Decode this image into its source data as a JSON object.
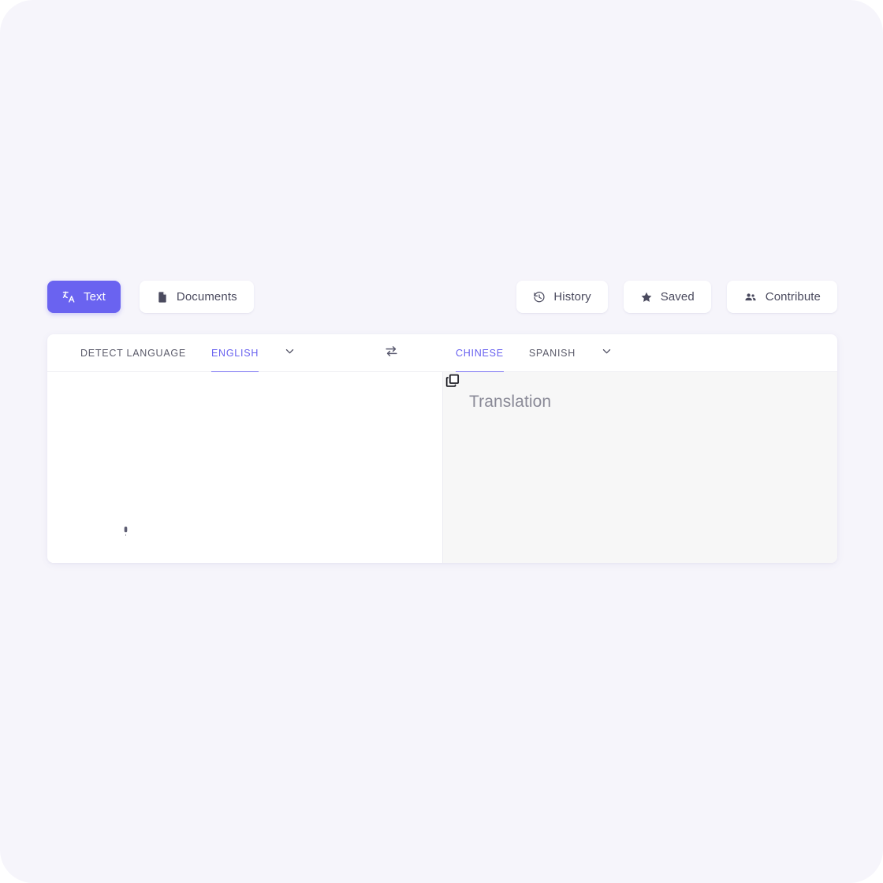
{
  "theme": {
    "accent": "#6a63f0",
    "accent_underline": "#7b74f2",
    "page_bg": "#f6f5fb",
    "card_bg": "#ffffff",
    "target_pane_bg": "#f7f7f7",
    "text_muted": "#5c5c6b",
    "placeholder": "#8a8a97"
  },
  "toolbar": {
    "left_items": [
      {
        "id": "text",
        "label": "Text",
        "icon": "translate-icon",
        "active": true
      },
      {
        "id": "documents",
        "label": "Documents",
        "icon": "document-icon",
        "active": false
      }
    ],
    "right_items": [
      {
        "id": "history",
        "label": "History",
        "icon": "history-icon"
      },
      {
        "id": "saved",
        "label": "Saved",
        "icon": "star-icon"
      },
      {
        "id": "contribute",
        "label": "Contribute",
        "icon": "people-icon"
      }
    ]
  },
  "translator": {
    "source": {
      "tabs": [
        {
          "label": "Detect language",
          "active": false
        },
        {
          "label": "English",
          "active": true
        }
      ],
      "dropdown_icon": "chevron-down-icon",
      "text_value": "",
      "mic_icon": "microphone-icon"
    },
    "swap_icon": "swap-arrows-icon",
    "target": {
      "tabs": [
        {
          "label": "Chinese",
          "active": true
        },
        {
          "label": "Spanish",
          "active": false
        }
      ],
      "dropdown_icon": "chevron-down-icon",
      "placeholder": "Translation",
      "copy_icon": "copy-icon"
    }
  }
}
